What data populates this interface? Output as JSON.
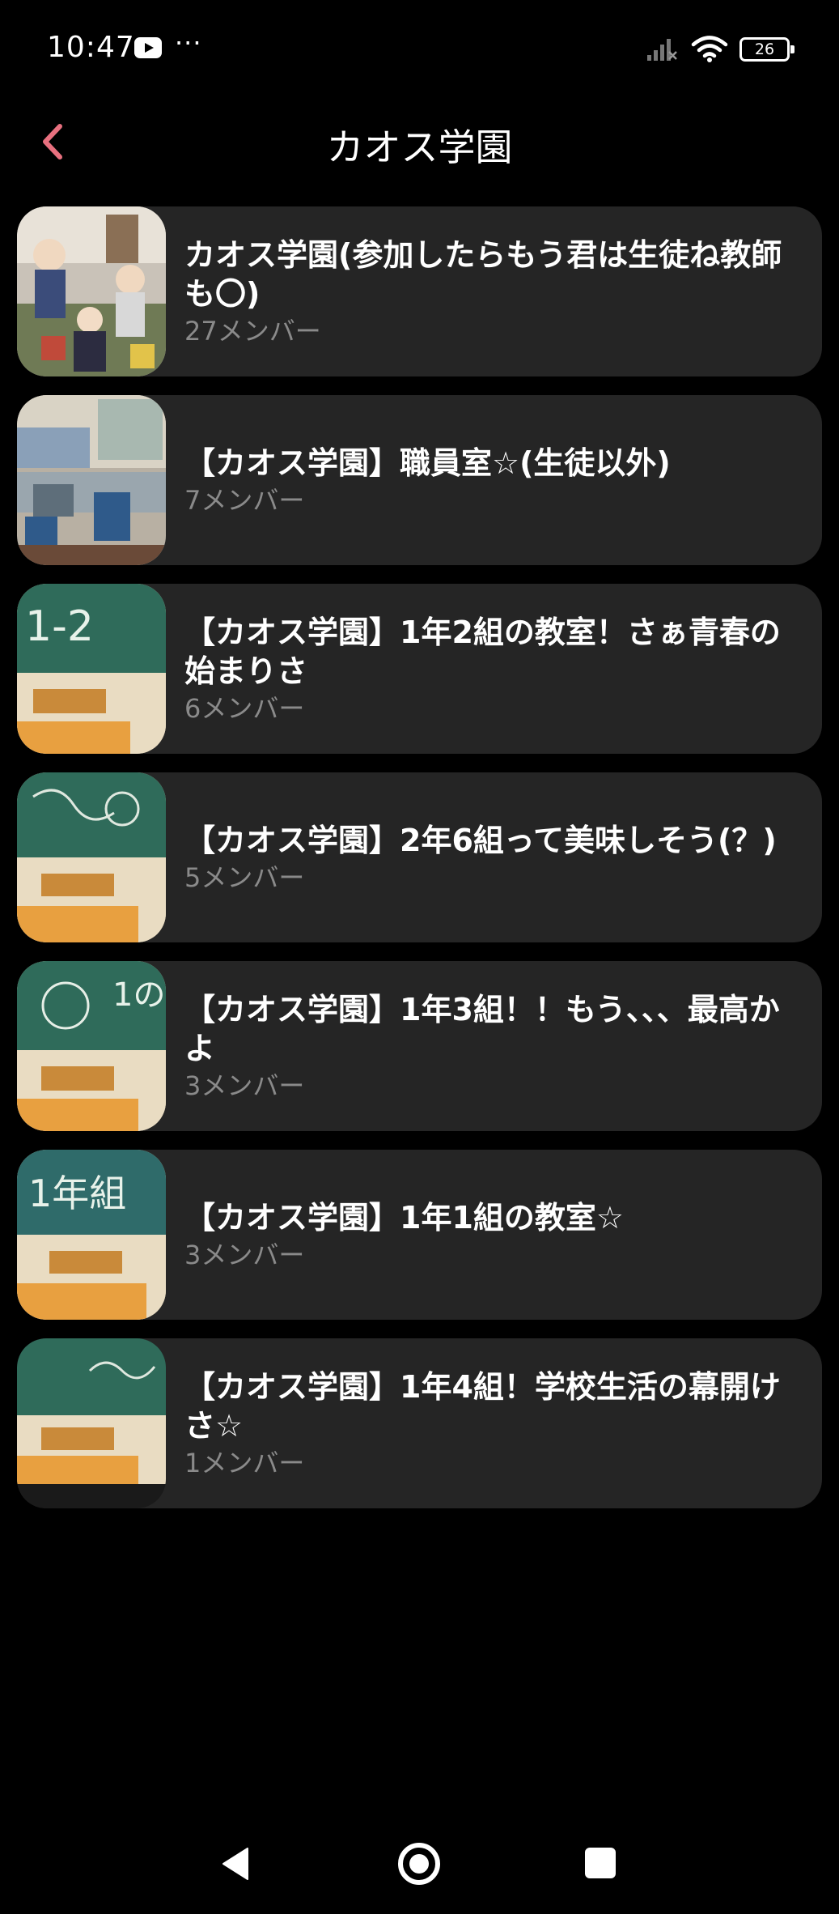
{
  "status_bar": {
    "time": "10:47",
    "dots": "···",
    "battery_level": "26"
  },
  "header": {
    "title": "カオス学園"
  },
  "chats": [
    {
      "title": "カオス学園(参加したらもう君は生徒ね教師も〇)",
      "members": "27メンバー",
      "thumb": "anime-students-crowd"
    },
    {
      "title": "【カオス学園】職員室☆(生徒以外)",
      "members": "7メンバー",
      "thumb": "staff-room"
    },
    {
      "title": "【カオス学園】1年2組の教室！さぁ青春の始まりさ",
      "members": "6メンバー",
      "thumb": "classroom-1-2"
    },
    {
      "title": "【カオス学園】2年6組って美味しそう(？)",
      "members": "5メンバー",
      "thumb": "classroom-2-6"
    },
    {
      "title": "【カオス学園】1年3組！！もう、、、最高かよ",
      "members": "3メンバー",
      "thumb": "classroom-1-3"
    },
    {
      "title": "【カオス学園】1年1組の教室☆",
      "members": "3メンバー",
      "thumb": "classroom-1-1"
    },
    {
      "title": "【カオス学園】1年4組！学校生活の幕開けさ☆",
      "members": "1メンバー",
      "thumb": "classroom-1-4"
    }
  ],
  "colors": {
    "background": "#000000",
    "card": "#252525",
    "accent": "#e8707f",
    "muted": "#8a8a8a"
  }
}
